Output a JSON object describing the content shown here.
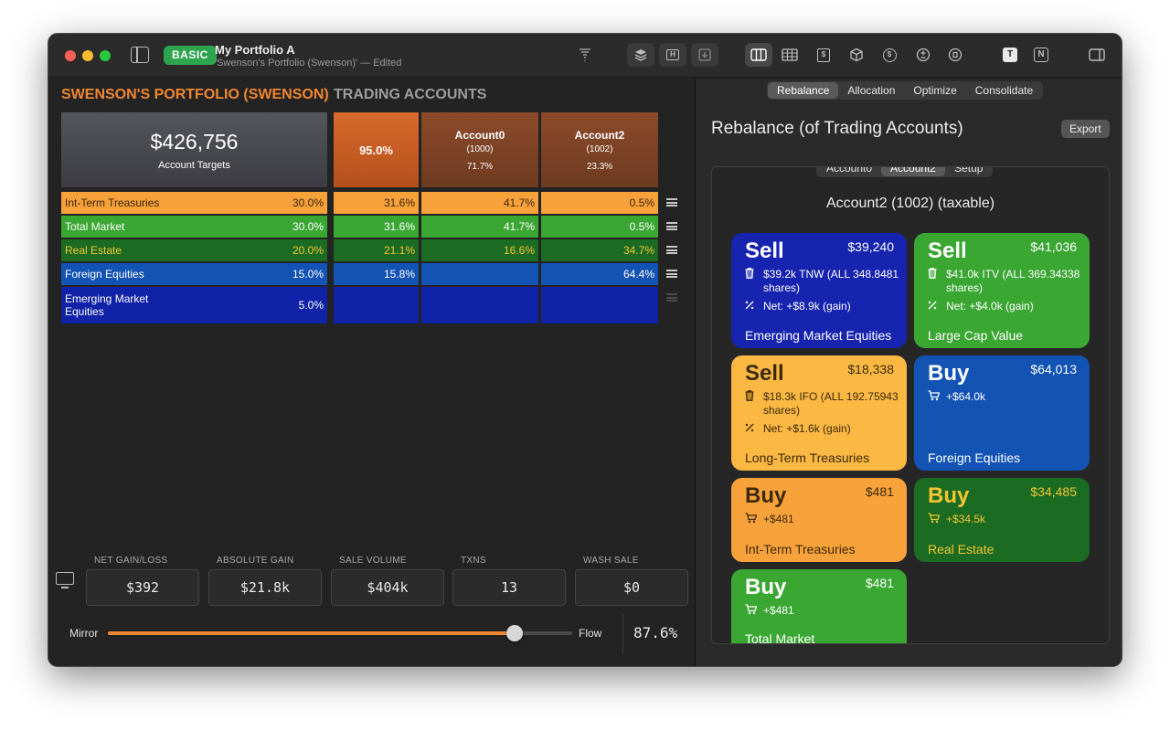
{
  "window": {
    "badge": "BASIC",
    "title": "My Portfolio A",
    "subtitle": "'Swenson's Portfolio (Swenson)' — Edited"
  },
  "toolbar": {
    "icons": [
      "funnel-icon",
      "layers-icon",
      "h-box-icon",
      "download-icon",
      "columns-icon",
      "table-icon",
      "dollar-box-icon",
      "cube-icon",
      "dollar-circle-icon",
      "plus-minus-circle-icon",
      "trash-circle-icon",
      "t-box-icon",
      "n-box-icon",
      "right-sidebar-icon"
    ],
    "t_label": "T",
    "n_label": "N",
    "h_label": "H",
    "dollar": "$"
  },
  "left": {
    "portfolio_header": "SWENSON'S PORTFOLIO (SWENSON)",
    "accounts_header": "TRADING ACCOUNTS",
    "target": {
      "value": "$426,756",
      "label": "Account Targets"
    },
    "summary_pct": "95.0%",
    "accounts": [
      {
        "name": "Account0",
        "number": "(1000)",
        "pct": "71.7%"
      },
      {
        "name": "Account2",
        "number": "(1002)",
        "pct": "23.3%"
      }
    ],
    "rows": [
      {
        "asset": "Int-Term Treasuries",
        "target": "30.0%",
        "total": "31.6%",
        "acct0": "41.7%",
        "acct2": "0.5%",
        "bg": "#f7a13a",
        "fg": "#3a2608"
      },
      {
        "asset": "Total Market",
        "target": "30.0%",
        "total": "31.6%",
        "acct0": "41.7%",
        "acct2": "0.5%",
        "bg": "#3aa733",
        "fg": "#ffffff"
      },
      {
        "asset": "Real Estate",
        "target": "20.0%",
        "total": "21.1%",
        "acct0": "16.6%",
        "acct2": "34.7%",
        "bg": "#1c6b22",
        "fg": "#f3c531"
      },
      {
        "asset": "Foreign Equities",
        "target": "15.0%",
        "total": "15.8%",
        "acct0": "",
        "acct2": "64.4%",
        "bg": "#1253b4",
        "fg": "#ffffff"
      },
      {
        "asset": "Emerging Market Equities",
        "target": "5.0%",
        "total": "",
        "acct0": "",
        "acct2": "",
        "bg": "#0f22a8",
        "fg": "#ffffff"
      }
    ],
    "stats": [
      {
        "label": "NET GAIN/LOSS",
        "value": "$392"
      },
      {
        "label": "ABSOLUTE GAIN",
        "value": "$21.8k"
      },
      {
        "label": "SALE VOLUME",
        "value": "$404k"
      },
      {
        "label": "TXNS",
        "value": "13"
      },
      {
        "label": "WASH SALE",
        "value": "$0"
      }
    ],
    "slider": {
      "left_label": "Mirror",
      "right_label": "Flow",
      "value": 0.876,
      "readout": "87.6%"
    }
  },
  "right": {
    "tabs": [
      "Rebalance",
      "Allocation",
      "Optimize",
      "Consolidate"
    ],
    "selected_tab": "Rebalance",
    "title": "Rebalance (of Trading Accounts)",
    "export_label": "Export",
    "subtabs": [
      "Account0",
      "Account2",
      "Setup"
    ],
    "selected_subtab": "Account2",
    "account_title": "Account2 (1002) (taxable)",
    "trades": [
      {
        "action": "Sell",
        "amount": "$39,240",
        "lines": [
          {
            "icon": "trash-icon",
            "text": "$39.2k TNW (ALL 348.8481 shares)"
          },
          {
            "icon": "percent-icon",
            "text": "Net: +$8.9k (gain)"
          }
        ],
        "fund": "Emerging Market Equities",
        "bg": "#1624b0",
        "fg": "#ffffff"
      },
      {
        "action": "Sell",
        "amount": "$41,036",
        "lines": [
          {
            "icon": "trash-icon",
            "text": "$41.0k ITV (ALL 369.34338 shares)"
          },
          {
            "icon": "percent-icon",
            "text": "Net: +$4.0k (gain)"
          }
        ],
        "fund": "Large Cap Value",
        "bg": "#3aa733",
        "fg": "#ffffff"
      },
      {
        "action": "Sell",
        "amount": "$18,338",
        "lines": [
          {
            "icon": "trash-icon",
            "text": "$18.3k IFO (ALL 192.75943 shares)"
          },
          {
            "icon": "percent-icon",
            "text": "Net: +$1.6k (gain)"
          }
        ],
        "fund": "Long-Term Treasuries",
        "bg": "#fbb843",
        "fg": "#3c2a0a"
      },
      {
        "action": "Buy",
        "amount": "$64,013",
        "lines": [
          {
            "icon": "cart-icon",
            "text": "+$64.0k"
          }
        ],
        "fund": "Foreign Equities",
        "bg": "#1253b4",
        "fg": "#ffffff"
      },
      {
        "action": "Buy",
        "amount": "$481",
        "lines": [
          {
            "icon": "cart-icon",
            "text": "+$481"
          }
        ],
        "fund": "Int-Term Treasuries",
        "bg": "#f8a23b",
        "fg": "#3c2a0a"
      },
      {
        "action": "Buy",
        "amount": "$34,485",
        "lines": [
          {
            "icon": "cart-icon",
            "text": "+$34.5k"
          }
        ],
        "fund": "Real Estate",
        "bg": "#1c6b22",
        "fg": "#f3c531"
      },
      {
        "action": "Buy",
        "amount": "$481",
        "lines": [
          {
            "icon": "cart-icon",
            "text": "+$481"
          }
        ],
        "fund": "Total Market",
        "bg": "#3aa733",
        "fg": "#ffffff"
      }
    ]
  }
}
